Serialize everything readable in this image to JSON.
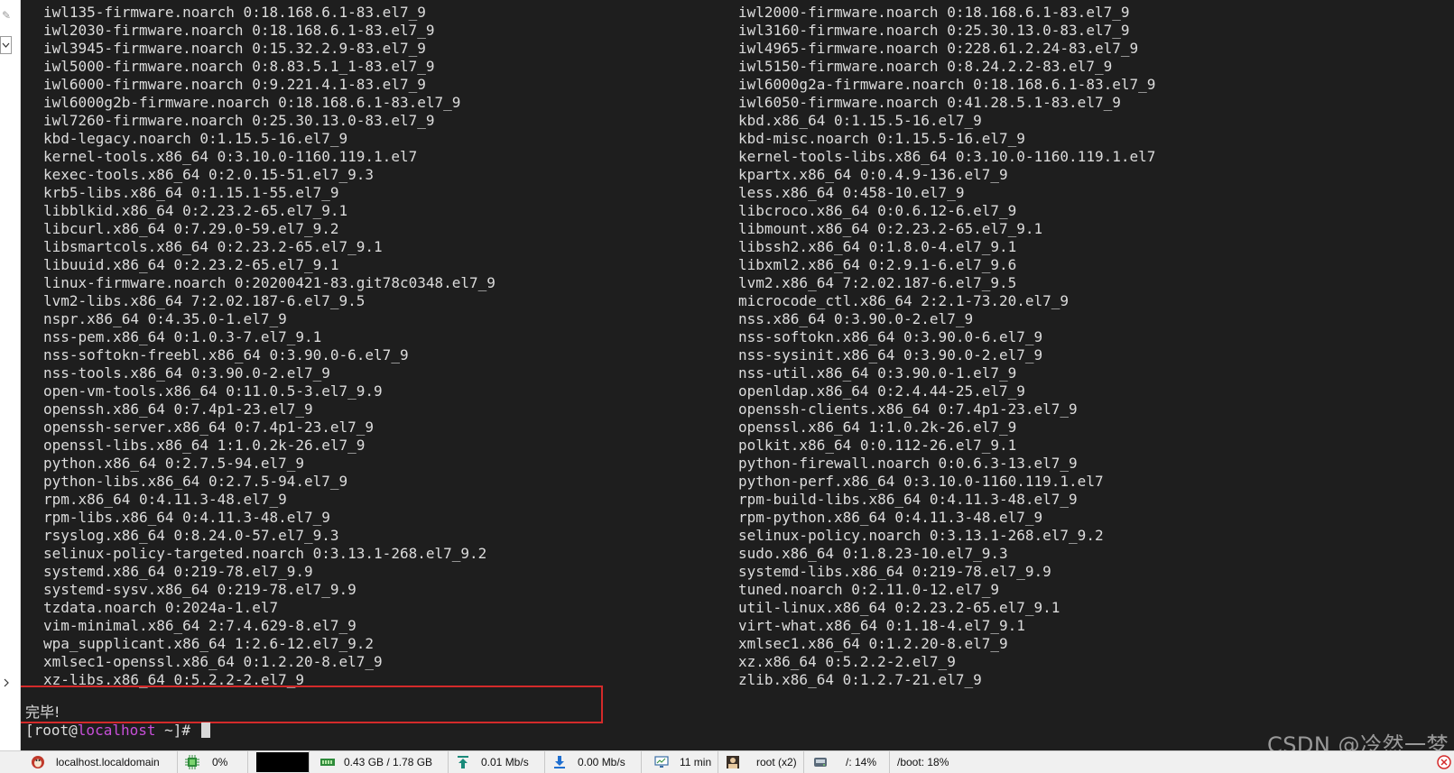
{
  "terminal": {
    "left_column": [
      "iwl135-firmware.noarch 0:18.168.6.1-83.el7_9",
      "iwl2030-firmware.noarch 0:18.168.6.1-83.el7_9",
      "iwl3945-firmware.noarch 0:15.32.2.9-83.el7_9",
      "iwl5000-firmware.noarch 0:8.83.5.1_1-83.el7_9",
      "iwl6000-firmware.noarch 0:9.221.4.1-83.el7_9",
      "iwl6000g2b-firmware.noarch 0:18.168.6.1-83.el7_9",
      "iwl7260-firmware.noarch 0:25.30.13.0-83.el7_9",
      "kbd-legacy.noarch 0:1.15.5-16.el7_9",
      "kernel-tools.x86_64 0:3.10.0-1160.119.1.el7",
      "kexec-tools.x86_64 0:2.0.15-51.el7_9.3",
      "krb5-libs.x86_64 0:1.15.1-55.el7_9",
      "libblkid.x86_64 0:2.23.2-65.el7_9.1",
      "libcurl.x86_64 0:7.29.0-59.el7_9.2",
      "libsmartcols.x86_64 0:2.23.2-65.el7_9.1",
      "libuuid.x86_64 0:2.23.2-65.el7_9.1",
      "linux-firmware.noarch 0:20200421-83.git78c0348.el7_9",
      "lvm2-libs.x86_64 7:2.02.187-6.el7_9.5",
      "nspr.x86_64 0:4.35.0-1.el7_9",
      "nss-pem.x86_64 0:1.0.3-7.el7_9.1",
      "nss-softokn-freebl.x86_64 0:3.90.0-6.el7_9",
      "nss-tools.x86_64 0:3.90.0-2.el7_9",
      "open-vm-tools.x86_64 0:11.0.5-3.el7_9.9",
      "openssh.x86_64 0:7.4p1-23.el7_9",
      "openssh-server.x86_64 0:7.4p1-23.el7_9",
      "openssl-libs.x86_64 1:1.0.2k-26.el7_9",
      "python.x86_64 0:2.7.5-94.el7_9",
      "python-libs.x86_64 0:2.7.5-94.el7_9",
      "rpm.x86_64 0:4.11.3-48.el7_9",
      "rpm-libs.x86_64 0:4.11.3-48.el7_9",
      "rsyslog.x86_64 0:8.24.0-57.el7_9.3",
      "selinux-policy-targeted.noarch 0:3.13.1-268.el7_9.2",
      "systemd.x86_64 0:219-78.el7_9.9",
      "systemd-sysv.x86_64 0:219-78.el7_9.9",
      "tzdata.noarch 0:2024a-1.el7",
      "vim-minimal.x86_64 2:7.4.629-8.el7_9",
      "wpa_supplicant.x86_64 1:2.6-12.el7_9.2",
      "xmlsec1-openssl.x86_64 0:1.2.20-8.el7_9",
      "xz-libs.x86_64 0:5.2.2-2.el7_9"
    ],
    "right_column": [
      "iwl2000-firmware.noarch 0:18.168.6.1-83.el7_9",
      "iwl3160-firmware.noarch 0:25.30.13.0-83.el7_9",
      "iwl4965-firmware.noarch 0:228.61.2.24-83.el7_9",
      "iwl5150-firmware.noarch 0:8.24.2.2-83.el7_9",
      "iwl6000g2a-firmware.noarch 0:18.168.6.1-83.el7_9",
      "iwl6050-firmware.noarch 0:41.28.5.1-83.el7_9",
      "kbd.x86_64 0:1.15.5-16.el7_9",
      "kbd-misc.noarch 0:1.15.5-16.el7_9",
      "kernel-tools-libs.x86_64 0:3.10.0-1160.119.1.el7",
      "kpartx.x86_64 0:0.4.9-136.el7_9",
      "less.x86_64 0:458-10.el7_9",
      "libcroco.x86_64 0:0.6.12-6.el7_9",
      "libmount.x86_64 0:2.23.2-65.el7_9.1",
      "libssh2.x86_64 0:1.8.0-4.el7_9.1",
      "libxml2.x86_64 0:2.9.1-6.el7_9.6",
      "lvm2.x86_64 7:2.02.187-6.el7_9.5",
      "microcode_ctl.x86_64 2:2.1-73.20.el7_9",
      "nss.x86_64 0:3.90.0-2.el7_9",
      "nss-softokn.x86_64 0:3.90.0-6.el7_9",
      "nss-sysinit.x86_64 0:3.90.0-2.el7_9",
      "nss-util.x86_64 0:3.90.0-1.el7_9",
      "openldap.x86_64 0:2.4.44-25.el7_9",
      "openssh-clients.x86_64 0:7.4p1-23.el7_9",
      "openssl.x86_64 1:1.0.2k-26.el7_9",
      "polkit.x86_64 0:0.112-26.el7_9.1",
      "python-firewall.noarch 0:0.6.3-13.el7_9",
      "python-perf.x86_64 0:3.10.0-1160.119.1.el7",
      "rpm-build-libs.x86_64 0:4.11.3-48.el7_9",
      "rpm-python.x86_64 0:4.11.3-48.el7_9",
      "selinux-policy.noarch 0:3.13.1-268.el7_9.2",
      "sudo.x86_64 0:1.8.23-10.el7_9.3",
      "systemd-libs.x86_64 0:219-78.el7_9.9",
      "tuned.noarch 0:2.11.0-12.el7_9",
      "util-linux.x86_64 0:2.23.2-65.el7_9.1",
      "virt-what.x86_64 0:1.18-4.el7_9.1",
      "xmlsec1.x86_64 0:1.2.20-8.el7_9",
      "xz.x86_64 0:5.2.2-2.el7_9",
      "zlib.x86_64 0:1.2.7-21.el7_9"
    ],
    "done_message": "完毕!",
    "prompt": {
      "open": "[root@",
      "host": "localhost",
      "rest": " ~]# "
    },
    "watermark": "CSDN @冷然一梦",
    "colors": {
      "background": "#1e1e1e",
      "foreground": "#dcdcdc",
      "hostname": "#c74fd8",
      "highlight_box": "#d42a2a"
    }
  },
  "statusbar": {
    "host": "localhost.localdomain",
    "cpu": "0%",
    "memory": "0.43 GB / 1.78 GB",
    "upload": "0.01 Mb/s",
    "download": "0.00 Mb/s",
    "uptime": "11 min",
    "user": "root (x2)",
    "disk_root": "/: 14%",
    "disk_boot": "/boot: 18%",
    "icons": [
      "linux-icon",
      "cpu-icon",
      "memory-icon",
      "upload-arrow-icon",
      "download-arrow-icon",
      "monitor-icon",
      "user-icon",
      "disk-icon",
      "close-icon"
    ]
  }
}
